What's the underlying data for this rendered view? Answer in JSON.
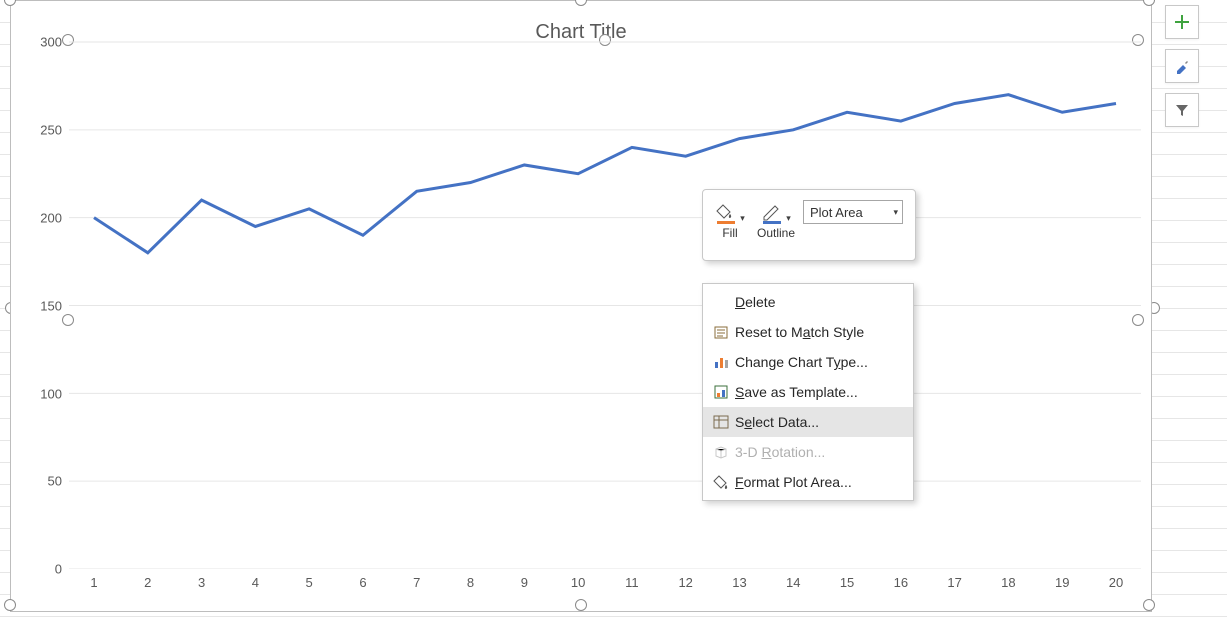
{
  "chart_data": {
    "type": "line",
    "title": "Chart Title",
    "xlabel": "",
    "ylabel": "",
    "ylim": [
      0,
      300
    ],
    "categories": [
      "1",
      "2",
      "3",
      "4",
      "5",
      "6",
      "7",
      "8",
      "9",
      "10",
      "11",
      "12",
      "13",
      "14",
      "15",
      "16",
      "17",
      "18",
      "19",
      "20"
    ],
    "values": [
      200,
      180,
      210,
      195,
      205,
      190,
      215,
      220,
      230,
      225,
      240,
      235,
      245,
      250,
      260,
      255,
      265,
      270,
      260,
      265
    ]
  },
  "y_ticks": [
    "0",
    "50",
    "100",
    "150",
    "200",
    "250",
    "300"
  ],
  "mini_toolbar": {
    "fill_label": "Fill",
    "outline_label": "Outline",
    "combo_value": "Plot Area"
  },
  "context_menu": {
    "delete": "Delete",
    "reset": "Reset to Match Style",
    "change_type": "Change Chart Type...",
    "save_template": "Save as Template...",
    "select_data": "Select Data...",
    "rotation": "3-D Rotation...",
    "format": "Format Plot Area..."
  },
  "side": {
    "add": "plus-icon",
    "style": "brush-icon",
    "filter": "filter-icon"
  }
}
